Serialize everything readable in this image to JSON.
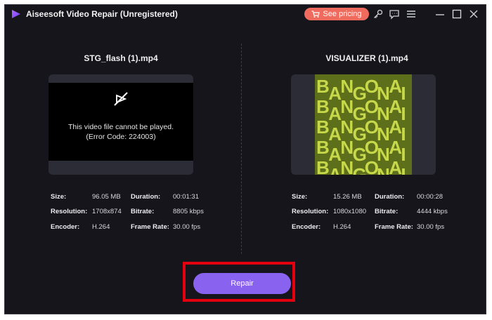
{
  "window": {
    "title": "Aiseesoft Video Repair (Unregistered)"
  },
  "toolbar": {
    "pricing_label": "See pricing",
    "icons": [
      "key-icon",
      "feedback-icon",
      "menu-icon",
      "minimize-icon",
      "maximize-icon",
      "close-icon"
    ]
  },
  "left": {
    "filename": "STG_flash (1).mp4",
    "error_line1": "This video file cannot be played.",
    "error_line2": "(Error Code: 224003)",
    "size_label": "Size:",
    "size": "96.05 MB",
    "duration_label": "Duration:",
    "duration": "00:01:31",
    "resolution_label": "Resolution:",
    "resolution": "1708x874",
    "bitrate_label": "Bitrate:",
    "bitrate": "8805 kbps",
    "encoder_label": "Encoder:",
    "encoder": "H.264",
    "framerate_label": "Frame Rate:",
    "framerate": "30.00 fps"
  },
  "right": {
    "filename": "VISUALIZER (1).mp4",
    "size_label": "Size:",
    "size": "15.26 MB",
    "duration_label": "Duration:",
    "duration": "00:00:28",
    "resolution_label": "Resolution:",
    "resolution": "1080x1080",
    "bitrate_label": "Bitrate:",
    "bitrate": "4444 kbps",
    "encoder_label": "Encoder:",
    "encoder": "H.264",
    "framerate_label": "Frame Rate:",
    "framerate": "30.00 fps",
    "thumbnail_text": [
      "BANGONAI",
      "BANGONAI",
      "BANGONAI",
      "BANGONAI",
      "BANGONAI"
    ]
  },
  "actions": {
    "repair_label": "Repair"
  },
  "colors": {
    "accent": "#8a62f0",
    "pricing": "#ef6b5d",
    "highlight": "#e3000f",
    "background": "#15151b"
  }
}
